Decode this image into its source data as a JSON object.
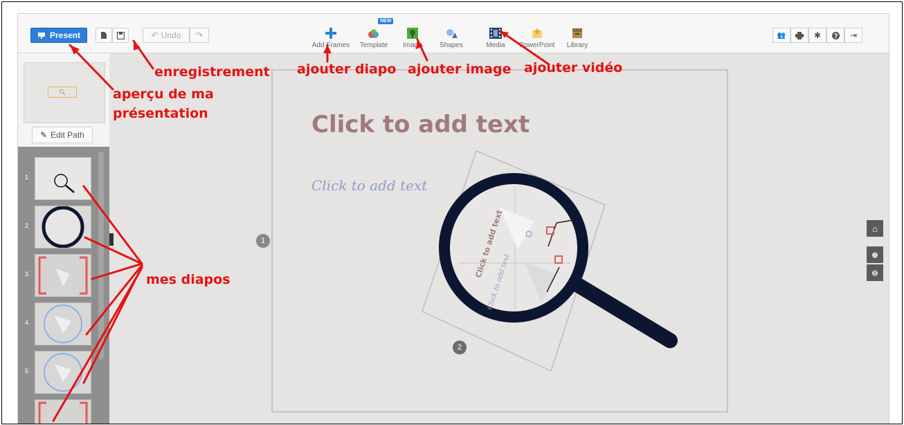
{
  "toolbar": {
    "present_label": "Present",
    "undo_label": "Undo",
    "new_badge": "NEW",
    "tools": [
      {
        "label": "Add Frames",
        "icon": "plus-icon"
      },
      {
        "label": "Template",
        "icon": "template-icon"
      },
      {
        "label": "Image",
        "icon": "image-icon"
      },
      {
        "label": "Shapes",
        "icon": "shapes-icon"
      },
      {
        "label": "Media",
        "icon": "film-icon"
      },
      {
        "label": "PowerPoint",
        "icon": "powerpoint-icon"
      },
      {
        "label": "Library",
        "icon": "library-icon"
      }
    ],
    "right_icons": [
      "users-icon",
      "print-icon",
      "gear-icon",
      "help-icon",
      "exit-icon"
    ]
  },
  "sidebar": {
    "edit_path_label": "Edit Path",
    "slides": [
      "1",
      "2",
      "3",
      "4",
      "5"
    ]
  },
  "canvas": {
    "title_placeholder": "Click to add text",
    "subtitle_placeholder": "Click to add text",
    "frame_numbers": [
      "1",
      "2"
    ],
    "lens_text_1": "Click to add text",
    "lens_text_2": "Click to add text"
  },
  "annotations": {
    "present": "aperçu de ma",
    "present_line2": "présentation",
    "save": "enregistrement",
    "add_frames": "ajouter diapo",
    "image": "ajouter image",
    "media": "ajouter vidéo",
    "slides": "mes diapos"
  },
  "colors": {
    "annotation": "#e31313",
    "present_button": "#2d7ed8",
    "title_text": "#a07a80",
    "subtitle_text": "#8c9ec8",
    "magnifier": "#0d1630"
  }
}
